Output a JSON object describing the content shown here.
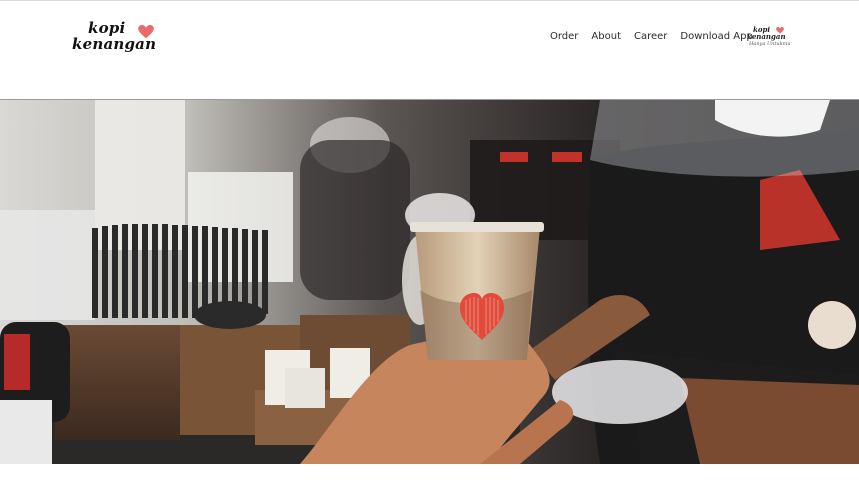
{
  "brand": {
    "logo_line1": "kopi",
    "logo_line2": "kenangan",
    "heart_color": "#e86b6b"
  },
  "nav": {
    "items": [
      {
        "label": "Order"
      },
      {
        "label": "About"
      },
      {
        "label": "Career"
      },
      {
        "label": "Download App"
      }
    ]
  },
  "secondary_logo": {
    "line1": "kopi",
    "line2": "kenangan",
    "tagline": "Hanya Untukmu"
  },
  "hero": {
    "image": "barista handing iced coffee with heart logo to customer",
    "cup_heart_color": "#e24a3b"
  }
}
